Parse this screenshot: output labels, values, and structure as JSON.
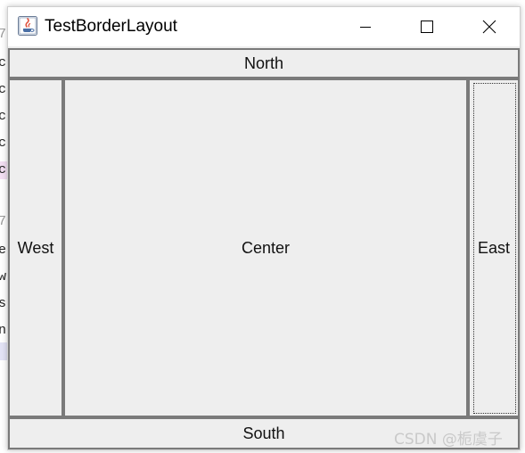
{
  "window": {
    "title": "TestBorderLayout",
    "controls": {
      "minimize": "minimize",
      "maximize": "maximize",
      "close": "close"
    }
  },
  "layout": {
    "north": "North",
    "west": "West",
    "center": "Center",
    "east": "East",
    "south": "South"
  },
  "watermark": "CSDN @栀虞子",
  "colors": {
    "panel_background": "#eeeeee",
    "button_border": "#7a7a7a",
    "titlebar_background": "#ffffff"
  },
  "background_editor": {
    "lines": [
      "7",
      "c",
      "c",
      "cl",
      "cl",
      "cc",
      "",
      "7",
      "ea",
      "w",
      "s",
      "nc"
    ]
  }
}
